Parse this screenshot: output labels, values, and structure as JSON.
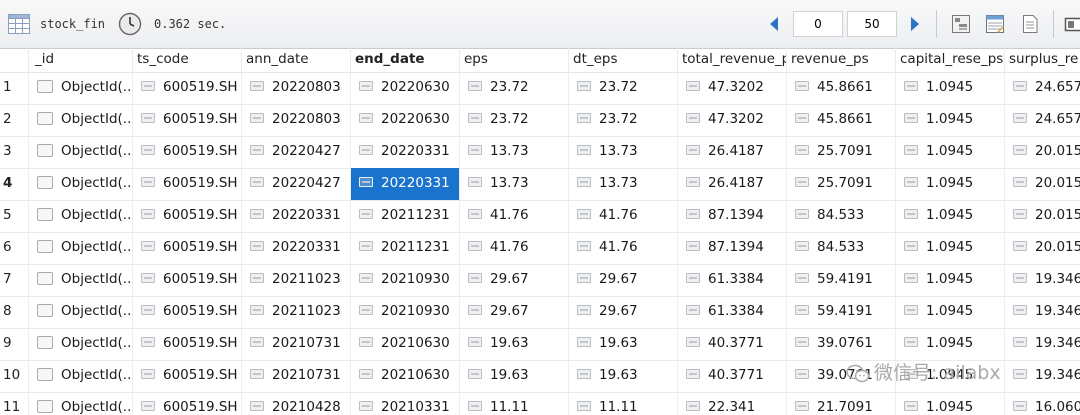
{
  "toolbar": {
    "collection_name": "stock_fin",
    "query_time": "0.362 sec.",
    "page_offset": "0",
    "page_limit": "50",
    "icons": [
      "grid-icon",
      "clock-icon",
      "prev-arrow-icon",
      "next-arrow-icon",
      "tree-view-icon",
      "table-view-icon",
      "text-view-icon",
      "panel-icon"
    ]
  },
  "columns": [
    "_id",
    "ts_code",
    "ann_date",
    "end_date",
    "eps",
    "dt_eps",
    "total_revenue_ps",
    "revenue_ps",
    "capital_rese_ps",
    "surplus_re"
  ],
  "sorted_column": "end_date",
  "selected_cell": {
    "row": 4,
    "column": "end_date"
  },
  "rows": [
    {
      "n": "1",
      "id": "ObjectId(...",
      "ts_code": "600519.SH",
      "ann_date": "20220803",
      "end_date": "20220630",
      "eps": "23.72",
      "dt_eps": "23.72",
      "total_revenue_ps": "47.3202",
      "revenue_ps": "45.8661",
      "capital_rese_ps": "1.0945",
      "surplus_re": "24.657"
    },
    {
      "n": "2",
      "id": "ObjectId(...",
      "ts_code": "600519.SH",
      "ann_date": "20220803",
      "end_date": "20220630",
      "eps": "23.72",
      "dt_eps": "23.72",
      "total_revenue_ps": "47.3202",
      "revenue_ps": "45.8661",
      "capital_rese_ps": "1.0945",
      "surplus_re": "24.657"
    },
    {
      "n": "3",
      "id": "ObjectId(...",
      "ts_code": "600519.SH",
      "ann_date": "20220427",
      "end_date": "20220331",
      "eps": "13.73",
      "dt_eps": "13.73",
      "total_revenue_ps": "26.4187",
      "revenue_ps": "25.7091",
      "capital_rese_ps": "1.0945",
      "surplus_re": "20.015"
    },
    {
      "n": "4",
      "id": "ObjectId(...",
      "ts_code": "600519.SH",
      "ann_date": "20220427",
      "end_date": "20220331",
      "eps": "13.73",
      "dt_eps": "13.73",
      "total_revenue_ps": "26.4187",
      "revenue_ps": "25.7091",
      "capital_rese_ps": "1.0945",
      "surplus_re": "20.015"
    },
    {
      "n": "5",
      "id": "ObjectId(...",
      "ts_code": "600519.SH",
      "ann_date": "20220331",
      "end_date": "20211231",
      "eps": "41.76",
      "dt_eps": "41.76",
      "total_revenue_ps": "87.1394",
      "revenue_ps": "84.533",
      "capital_rese_ps": "1.0945",
      "surplus_re": "20.015"
    },
    {
      "n": "6",
      "id": "ObjectId(...",
      "ts_code": "600519.SH",
      "ann_date": "20220331",
      "end_date": "20211231",
      "eps": "41.76",
      "dt_eps": "41.76",
      "total_revenue_ps": "87.1394",
      "revenue_ps": "84.533",
      "capital_rese_ps": "1.0945",
      "surplus_re": "20.015"
    },
    {
      "n": "7",
      "id": "ObjectId(...",
      "ts_code": "600519.SH",
      "ann_date": "20211023",
      "end_date": "20210930",
      "eps": "29.67",
      "dt_eps": "29.67",
      "total_revenue_ps": "61.3384",
      "revenue_ps": "59.4191",
      "capital_rese_ps": "1.0945",
      "surplus_re": "19.346"
    },
    {
      "n": "8",
      "id": "ObjectId(...",
      "ts_code": "600519.SH",
      "ann_date": "20211023",
      "end_date": "20210930",
      "eps": "29.67",
      "dt_eps": "29.67",
      "total_revenue_ps": "61.3384",
      "revenue_ps": "59.4191",
      "capital_rese_ps": "1.0945",
      "surplus_re": "19.346"
    },
    {
      "n": "9",
      "id": "ObjectId(...",
      "ts_code": "600519.SH",
      "ann_date": "20210731",
      "end_date": "20210630",
      "eps": "19.63",
      "dt_eps": "19.63",
      "total_revenue_ps": "40.3771",
      "revenue_ps": "39.0761",
      "capital_rese_ps": "1.0945",
      "surplus_re": "19.346"
    },
    {
      "n": "10",
      "id": "ObjectId(...",
      "ts_code": "600519.SH",
      "ann_date": "20210731",
      "end_date": "20210630",
      "eps": "19.63",
      "dt_eps": "19.63",
      "total_revenue_ps": "40.3771",
      "revenue_ps": "39.0761",
      "capital_rese_ps": "1.0945",
      "surplus_re": "19.346"
    },
    {
      "n": "11",
      "id": "ObjectId(...",
      "ts_code": "600519.SH",
      "ann_date": "20210428",
      "end_date": "20210331",
      "eps": "11.11",
      "dt_eps": "11.11",
      "total_revenue_ps": "22.341",
      "revenue_ps": "21.7091",
      "capital_rese_ps": "1.0945",
      "surplus_re": "16.060"
    }
  ],
  "watermark": {
    "text": "微信号: ailabx",
    "icon": "wechat-icon"
  }
}
